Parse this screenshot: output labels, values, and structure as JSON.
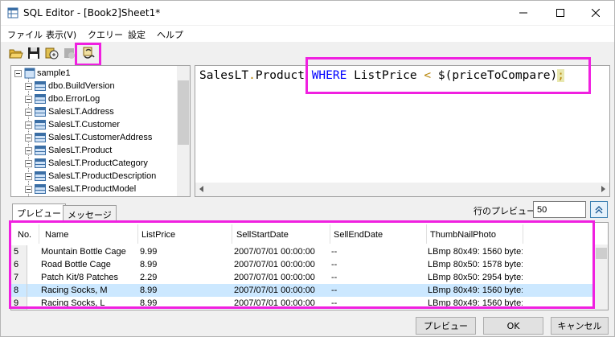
{
  "window": {
    "title": "SQL Editor - [Book2]Sheet1*"
  },
  "menu": [
    "ファイル",
    "表示(V)",
    "クエリー",
    "設定",
    "ヘルプ"
  ],
  "toolbar": {
    "icons": [
      "open-folder-icon",
      "save-icon",
      "run-query-icon",
      "disabled-icon",
      "link-query-icon"
    ]
  },
  "tree": {
    "root": "sample1",
    "items": [
      "dbo.BuildVersion",
      "dbo.ErrorLog",
      "SalesLT.Address",
      "SalesLT.Customer",
      "SalesLT.CustomerAddress",
      "SalesLT.Product",
      "SalesLT.ProductCategory",
      "SalesLT.ProductDescription",
      "SalesLT.ProductModel"
    ]
  },
  "editor": {
    "prefix": "SalesLT",
    "dot": ".",
    "table": "Product",
    "keyword": "WHERE",
    "column": "ListPrice",
    "operator": "<",
    "param": "$(priceToCompare)",
    "terminator": ";"
  },
  "tabs": [
    {
      "label": "プレビュー",
      "active": true
    },
    {
      "label": "メッセージ",
      "active": false
    }
  ],
  "preview_rows": {
    "label": "行のプレビュー:",
    "value": "50"
  },
  "grid": {
    "columns": [
      "No.",
      "Name",
      "ListPrice",
      "SellStartDate",
      "SellEndDate",
      "ThumbNailPhoto"
    ],
    "rows": [
      {
        "no": "5",
        "name": "Mountain Bottle Cage",
        "price": "9.99",
        "start": "2007/07/01 00:00:00",
        "end": "--",
        "photo": "LBmp 80x49: 1560 byte:"
      },
      {
        "no": "6",
        "name": "Road Bottle Cage",
        "price": "8.99",
        "start": "2007/07/01 00:00:00",
        "end": "--",
        "photo": "LBmp 80x50: 1578 byte:"
      },
      {
        "no": "7",
        "name": "Patch Kit/8 Patches",
        "price": "2.29",
        "start": "2007/07/01 00:00:00",
        "end": "--",
        "photo": "LBmp 80x50: 2954 byte:"
      },
      {
        "no": "8",
        "name": "Racing Socks, M",
        "price": "8.99",
        "start": "2007/07/01 00:00:00",
        "end": "--",
        "photo": "LBmp 80x49: 1560 byte:",
        "selected": true
      },
      {
        "no": "9",
        "name": "Racing Socks, L",
        "price": "8.99",
        "start": "2007/07/01 00:00:00",
        "end": "--",
        "photo": "LBmp 80x49: 1560 byte:"
      }
    ]
  },
  "buttons": {
    "preview": "プレビュー",
    "ok": "OK",
    "cancel": "キャンセル"
  },
  "colors": {
    "highlight": "#f020e0",
    "keyword": "#0000ff",
    "operator": "#b8860b",
    "selected_row": "#cce8ff"
  }
}
